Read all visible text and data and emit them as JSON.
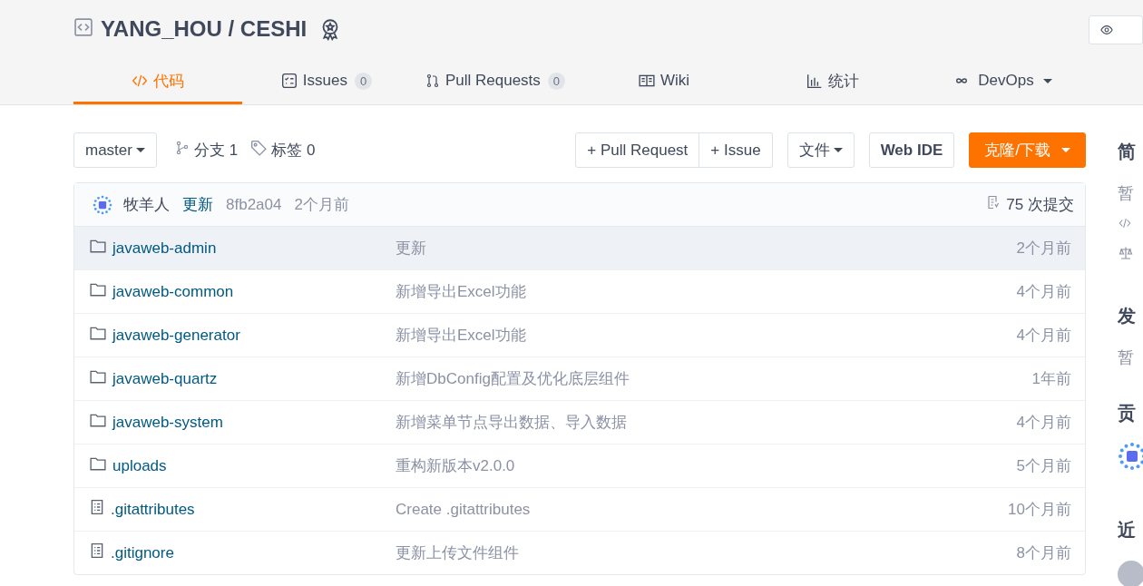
{
  "repo": {
    "title": "YANG_HOU / CESHI"
  },
  "tabs": [
    {
      "kind": "code",
      "label": "代码",
      "selected": true
    },
    {
      "kind": "issues",
      "label": "Issues",
      "count": "0",
      "selected": false
    },
    {
      "kind": "pr",
      "label": "Pull Requests",
      "count": "0",
      "selected": false
    },
    {
      "kind": "wiki",
      "label": "Wiki",
      "selected": false
    },
    {
      "kind": "stats",
      "label": "统计",
      "selected": false
    },
    {
      "kind": "devops",
      "label": "DevOps",
      "selected": false
    }
  ],
  "toolbar": {
    "branch": "master",
    "branches": "分支 1",
    "tags": "标签 0",
    "pull_request": "+ Pull Request",
    "issue": "+ Issue",
    "files": "文件",
    "web_ide": "Web IDE",
    "clone": "克隆/下载"
  },
  "commit": {
    "author": "牧羊人",
    "message": "更新",
    "hash": "8fb2a04",
    "time": "2个月前",
    "count": "75 次提交"
  },
  "files": [
    {
      "kind": "folder",
      "name": "javaweb-admin",
      "message": "更新",
      "time": "2个月前",
      "selected": true
    },
    {
      "kind": "folder",
      "name": "javaweb-common",
      "message": "新增导出Excel功能",
      "time": "4个月前",
      "selected": false
    },
    {
      "kind": "folder",
      "name": "javaweb-generator",
      "message": "新增导出Excel功能",
      "time": "4个月前",
      "selected": false
    },
    {
      "kind": "folder",
      "name": "javaweb-quartz",
      "message": "新增DbConfig配置及优化底层组件",
      "time": "1年前",
      "selected": false
    },
    {
      "kind": "folder",
      "name": "javaweb-system",
      "message": "新增菜单节点导出数据、导入数据",
      "time": "4个月前",
      "selected": false
    },
    {
      "kind": "folder",
      "name": "uploads",
      "message": "重构新版本v2.0.0",
      "time": "5个月前",
      "selected": false
    },
    {
      "kind": "file",
      "name": ".gitattributes",
      "message": "Create .gitattributes",
      "time": "10个月前",
      "selected": false
    },
    {
      "kind": "file",
      "name": ".gitignore",
      "message": "更新上传文件组件",
      "time": "8个月前",
      "selected": false
    }
  ],
  "sidebar": {
    "intro_heading": "简",
    "intro_text": "暂",
    "releases_heading": "发",
    "releases_text": "暂",
    "contributors_heading": "贡",
    "recent_heading": "近"
  }
}
